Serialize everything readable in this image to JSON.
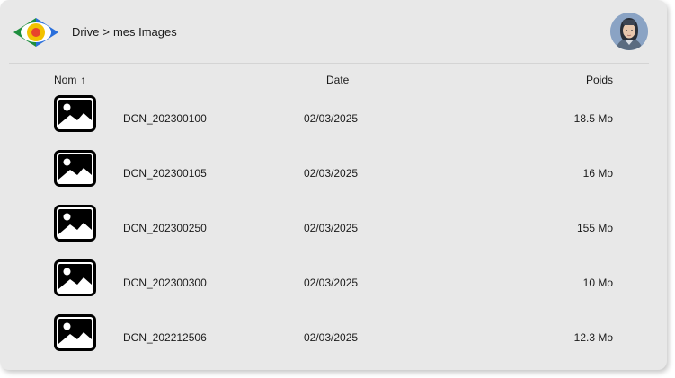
{
  "header": {
    "breadcrumb": [
      "Drive",
      ">",
      "mes Images"
    ]
  },
  "columns": {
    "name": "Nom",
    "name_sort_arrow": "↑",
    "date": "Date",
    "size": "Poids"
  },
  "files": [
    {
      "name": "DCN_202300100",
      "date": "02/03/2025",
      "size": "18.5 Mo"
    },
    {
      "name": "DCN_202300105",
      "date": "02/03/2025",
      "size": "16 Mo"
    },
    {
      "name": "DCN_202300250",
      "date": "02/03/2025",
      "size": "155 Mo"
    },
    {
      "name": "DCN_202300300",
      "date": "02/03/2025",
      "size": "10 Mo"
    },
    {
      "name": "DCN_202212506",
      "date": "02/03/2025",
      "size": "12.3 Mo"
    }
  ],
  "icons": {
    "logo": "eye-logo-icon",
    "file": "image-file-icon",
    "avatar": "user-avatar"
  },
  "colors": {
    "window_bg": "#e8e8e8",
    "logo_green": "#1e8e3e",
    "logo_blue": "#2a6fdb",
    "logo_yellow": "#f2c200",
    "logo_red": "#e8452c"
  }
}
